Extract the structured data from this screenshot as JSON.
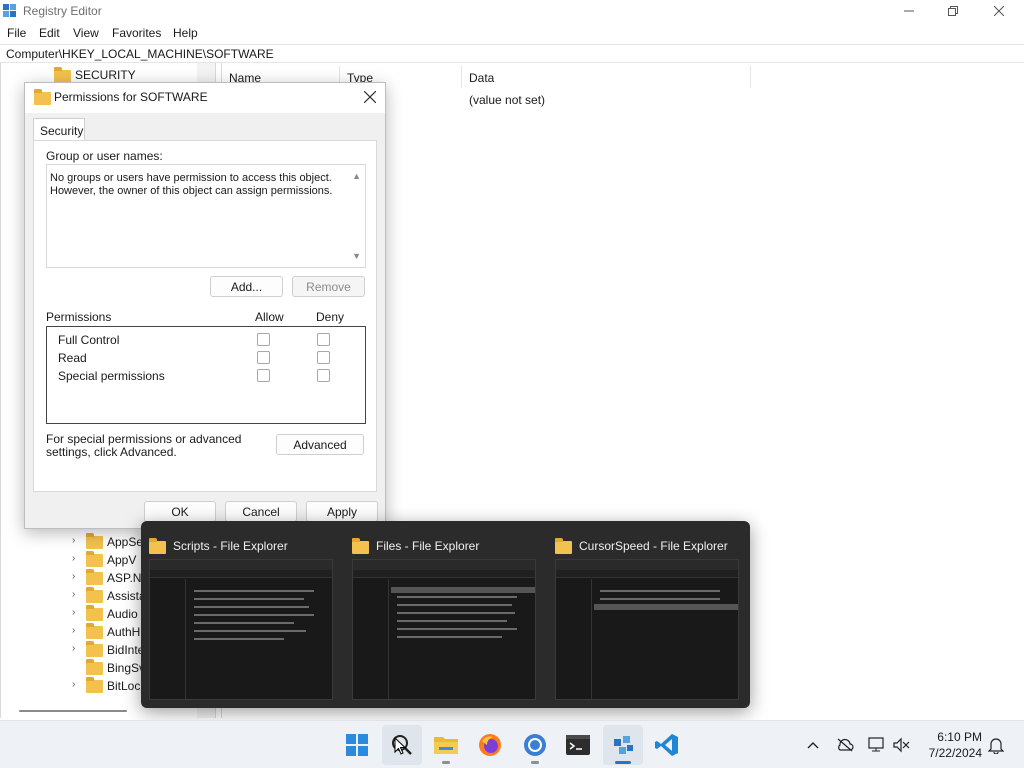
{
  "window": {
    "title": "Registry Editor",
    "address": "Computer\\HKEY_LOCAL_MACHINE\\SOFTWARE"
  },
  "menu": [
    "File",
    "Edit",
    "View",
    "Favorites",
    "Help"
  ],
  "tree": {
    "top_item": "SECURITY",
    "items": [
      "AppSe",
      "AppV",
      "ASP.N",
      "Assista",
      "Audio",
      "AuthH",
      "BidInte",
      "BingSv",
      "BitLoc"
    ]
  },
  "data_pane": {
    "columns": [
      "Name",
      "Type",
      "Data"
    ],
    "row_value": "(value not set)"
  },
  "dialog": {
    "title": "Permissions for SOFTWARE",
    "tab": "Security",
    "group_label": "Group or user names:",
    "group_message": "No groups or users have permission to access this object. However, the owner of this object can assign permissions.",
    "add_button": "Add...",
    "remove_button": "Remove",
    "permissions_label": "Permissions",
    "allow_label": "Allow",
    "deny_label": "Deny",
    "permissions": [
      "Full Control",
      "Read",
      "Special permissions"
    ],
    "special_text": "For special permissions or advanced settings, click Advanced.",
    "advanced_button": "Advanced",
    "ok_button": "OK",
    "cancel_button": "Cancel",
    "apply_button": "Apply"
  },
  "thumbnails": [
    {
      "title": "Scripts - File Explorer"
    },
    {
      "title": "Files - File Explorer"
    },
    {
      "title": "CursorSpeed - File Explorer"
    }
  ],
  "taskbar": {
    "icons": [
      "start-icon",
      "search-icon",
      "file-explorer-icon",
      "firefox-icon",
      "chrome-icon",
      "terminal-icon",
      "registry-editor-icon",
      "vscode-icon"
    ],
    "time": "6:10 PM",
    "date": "7/22/2024"
  }
}
